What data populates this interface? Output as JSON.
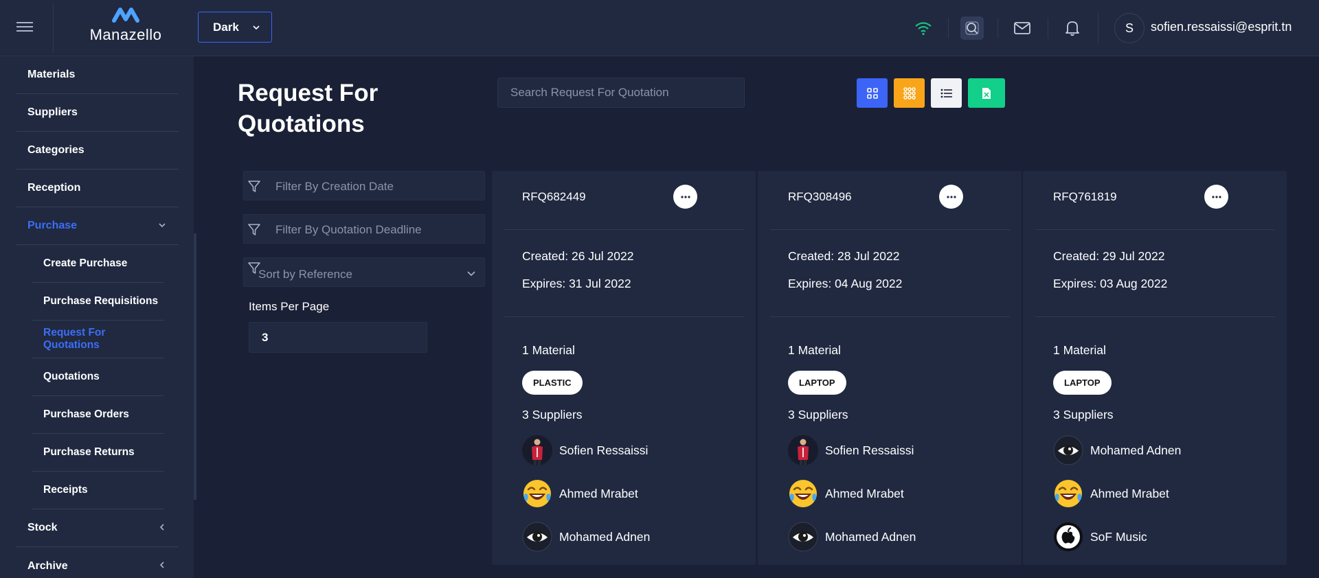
{
  "header": {
    "logo_text": "Manazello",
    "theme_select": "Dark",
    "user_initial": "S",
    "user_email": "sofien.ressaissi@esprit.tn"
  },
  "sidebar": {
    "items": [
      {
        "label": "Materials"
      },
      {
        "label": "Suppliers"
      },
      {
        "label": "Categories"
      },
      {
        "label": "Reception"
      },
      {
        "label": "Purchase",
        "active": true,
        "expanded": true
      },
      {
        "label": "Stock"
      },
      {
        "label": "Archive"
      }
    ],
    "purchase_sub": [
      {
        "label": "Create Purchase"
      },
      {
        "label": "Purchase Requisitions"
      },
      {
        "label": "Request For Quotations",
        "active": true
      },
      {
        "label": "Quotations"
      },
      {
        "label": "Purchase Orders"
      },
      {
        "label": "Purchase Returns"
      },
      {
        "label": "Receipts"
      }
    ]
  },
  "main": {
    "title": "Request For Quotations",
    "search_placeholder": "Search Request For Quotation",
    "filters": {
      "creation_date": "Filter By Creation Date",
      "quotation_deadline": "Filter By Quotation Deadline",
      "sort": "Sort by Reference"
    },
    "items_per_page_label": "Items Per Page",
    "items_per_page": "3",
    "colors": {
      "grid_view": "#3c64f6",
      "compact_view": "#f9a51a",
      "list_view": "#f1f2f6",
      "export": "#12cf8a"
    }
  },
  "cards": [
    {
      "ref": "RFQ682449",
      "created": "Created: 26 Jul 2022",
      "expires": "Expires: 31 Jul 2022",
      "materials_count": "1 Material",
      "material_tag": "PLASTIC",
      "suppliers_count": "3 Suppliers",
      "suppliers": [
        {
          "name": "Sofien Ressaissi",
          "avatar": "person-photo"
        },
        {
          "name": "Ahmed Mrabet",
          "avatar": "laughing-emoji"
        },
        {
          "name": "Mohamed Adnen",
          "avatar": "eye"
        }
      ]
    },
    {
      "ref": "RFQ308496",
      "created": "Created: 28 Jul 2022",
      "expires": "Expires: 04 Aug 2022",
      "materials_count": "1 Material",
      "material_tag": "LAPTOP",
      "suppliers_count": "3 Suppliers",
      "suppliers": [
        {
          "name": "Sofien Ressaissi",
          "avatar": "person-photo"
        },
        {
          "name": "Ahmed Mrabet",
          "avatar": "laughing-emoji"
        },
        {
          "name": "Mohamed Adnen",
          "avatar": "eye"
        }
      ]
    },
    {
      "ref": "RFQ761819",
      "created": "Created: 29 Jul 2022",
      "expires": "Expires: 03 Aug 2022",
      "materials_count": "1 Material",
      "material_tag": "LAPTOP",
      "suppliers_count": "3 Suppliers",
      "suppliers": [
        {
          "name": "Mohamed Adnen",
          "avatar": "eye"
        },
        {
          "name": "Ahmed Mrabet",
          "avatar": "laughing-emoji"
        },
        {
          "name": "SoF Music",
          "avatar": "apple-logo"
        }
      ]
    }
  ]
}
